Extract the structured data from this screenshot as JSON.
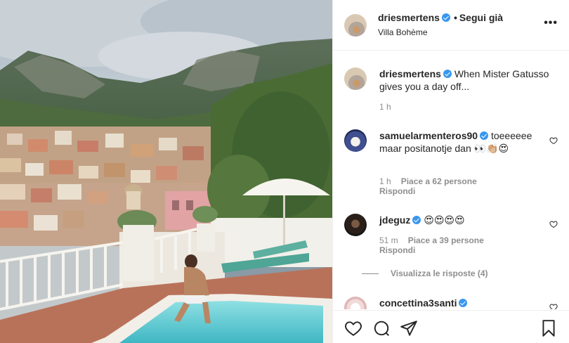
{
  "post": {
    "author": "driesmertens",
    "follow_sep": "•",
    "follow_label": "Segui già",
    "location": "Villa Bohème",
    "more_label": "•••"
  },
  "caption": {
    "user": "driesmertens",
    "text": "When Mister Gatusso gives you a day off...",
    "time": "1 h"
  },
  "comments": [
    {
      "user": "samuelarmenteros90",
      "text": "toeeeeee maar positanotje dan 👀👏🏼😍",
      "time": "1 h",
      "likes": "Piace a 62 persone",
      "reply": "Rispondi"
    },
    {
      "user": "jdeguz",
      "text": "😍😍😍😍",
      "time": "51 m",
      "likes": "Piace a 39 persone",
      "reply": "Rispondi",
      "view_replies": "Visualizza le risposte (4)"
    },
    {
      "user": "concettina3santi",
      "text": ""
    }
  ],
  "icons": {
    "verified": "verified-badge-icon",
    "like": "heart-icon",
    "comment": "comment-icon",
    "share": "paper-plane-icon",
    "save": "bookmark-icon",
    "more": "more-options-icon"
  },
  "colors": {
    "verified": "#3897f0",
    "muted": "#8e8e8e",
    "text": "#262626",
    "divider": "#efefef"
  }
}
